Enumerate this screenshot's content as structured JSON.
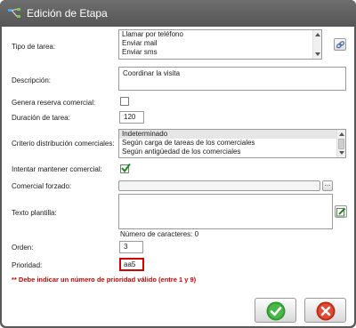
{
  "window": {
    "title": "Edición de Etapa"
  },
  "form": {
    "tipo_tarea": {
      "label": "Tipo de tarea:",
      "options": [
        "Llamar por teléfono",
        "Enviar mail",
        "Enviar sms"
      ]
    },
    "descripcion": {
      "label": "Descripción:",
      "value": "Coordinar la visita"
    },
    "genera_reserva": {
      "label": "Genera reserva comercial:",
      "checked": false
    },
    "duracion": {
      "label": "Duración de tarea:",
      "value": "120"
    },
    "criterio": {
      "label": "Criterio distribución comerciales:",
      "options": [
        "Indeterminado",
        "Según carga de tareas de los comerciales",
        "Según antigüedad de los comerciales"
      ]
    },
    "mantener_comercial": {
      "label": "Intentar mantener comercial:",
      "checked": true
    },
    "comercial_forzado": {
      "label": "Comercial forzado:",
      "value": "",
      "browse_label": "..."
    },
    "texto_plantilla": {
      "label": "Texto plantilla:",
      "value": "",
      "char_count": "Número de caracteres: 0"
    },
    "orden": {
      "label": "Orden:",
      "value": "3"
    },
    "prioridad": {
      "label": "Prioridad:",
      "value": "aa5"
    },
    "error": "** Debe indicar un número de prioridad válido (entre 1 y 9)"
  },
  "icons": {
    "app": "workflow-icon",
    "link": "link-icon",
    "edit": "edit-icon",
    "ok": "checkmark-icon",
    "cancel": "cancel-icon"
  },
  "colors": {
    "titlebar": "#5a5a5a",
    "error": "#cc0000",
    "ok_green": "#2e9a2e",
    "cancel_red": "#d2311f",
    "invalid_border": "#d80000"
  }
}
